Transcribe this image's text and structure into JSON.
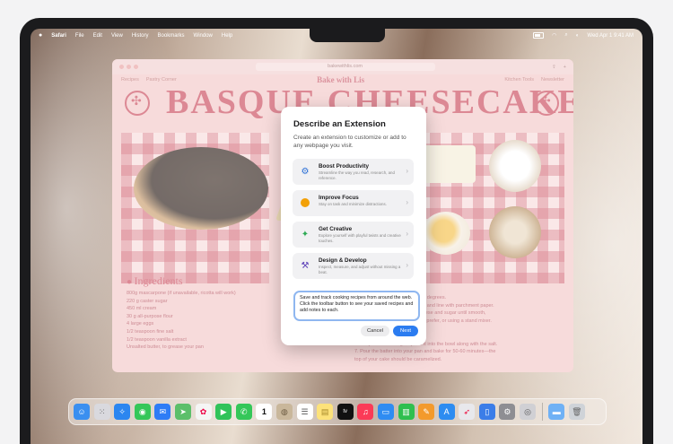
{
  "menubar": {
    "apple": "",
    "app": "Safari",
    "items": [
      "File",
      "Edit",
      "View",
      "History",
      "Bookmarks",
      "Window",
      "Help"
    ],
    "datetime": "Wed Apr 1  9:41 AM"
  },
  "browser": {
    "url": "bakewithlis.com",
    "nav_left": [
      "Recipes",
      "Pastry Corner"
    ],
    "brand": "Bake with Lis",
    "nav_right": [
      "Kitchen Tools",
      "Newsletter"
    ],
    "hero_title": "BASQUE CHEESECAKE",
    "ingredients_title": "Ingredients",
    "ingredients": [
      "800g mascarpone (if unavailable, ricotta will work)",
      "220 g caster sugar",
      "450 ml cream",
      "30 g all-purpose flour",
      "4 large eggs",
      "1/2 teaspoon fine salt",
      "1/2 teaspoon vanilla extract",
      "Unsalted butter, to grease your pan"
    ],
    "steps": [
      "350 degrees.",
      "pan and line with parchment paper.",
      "cheese and sugar until smooth,",
      "you prefer, or using a stand mixer.",
      "",
      "5. Mix in cream until combined.",
      "6. Sift your flour and gently mix it into the bowl along with the salt.",
      "7. Pour the batter into your pan and bake for 50-60 minutes—the",
      "   top of your cake should be caramelized."
    ]
  },
  "modal": {
    "title": "Describe an Extension",
    "description": "Create an extension to customize or add to any webpage you visit.",
    "options": [
      {
        "title": "Boost Productivity",
        "desc": "Streamline the way you read, research, and reference.",
        "icon": "gear-icon",
        "color": "#2b6fd6"
      },
      {
        "title": "Improve Focus",
        "desc": "Stay on task and minimize distractions.",
        "icon": "focus-icon",
        "color": "#f2a007"
      },
      {
        "title": "Get Creative",
        "desc": "Explore yourself with playful twists and creative touches.",
        "icon": "sparkles-icon",
        "color": "#2faa55"
      },
      {
        "title": "Design & Develop",
        "desc": "Inspect, measure, and adjust without missing a beat.",
        "icon": "hammer-icon",
        "color": "#5b3fb8"
      }
    ],
    "prompt": "Save and track cooking recipes from around the web. Click the toolbar button to see your saved recipes and add notes to each.",
    "cancel": "Cancel",
    "next": "Next"
  },
  "dock": {
    "calendar_day": "1",
    "tv_label": "tv",
    "apps": [
      {
        "name": "finder",
        "color": "#3a8ff0"
      },
      {
        "name": "launchpad",
        "color": "#d9d9de"
      },
      {
        "name": "safari",
        "color": "#2b86f0"
      },
      {
        "name": "messages",
        "color": "#34c759"
      },
      {
        "name": "mail",
        "color": "#2e7cf6"
      },
      {
        "name": "maps",
        "color": "#5cbf6a"
      },
      {
        "name": "photos",
        "color": "#f5f5f5"
      },
      {
        "name": "facetime",
        "color": "#30c35a"
      },
      {
        "name": "phone",
        "color": "#34c759"
      },
      {
        "name": "calendar",
        "color": "#ffffff"
      },
      {
        "name": "contacts",
        "color": "#c9b79b"
      },
      {
        "name": "reminders",
        "color": "#ffffff"
      },
      {
        "name": "notes",
        "color": "#fde27a"
      },
      {
        "name": "tv",
        "color": "#111111"
      },
      {
        "name": "music",
        "color": "#fb3b57"
      },
      {
        "name": "keynote",
        "color": "#2f8cf2"
      },
      {
        "name": "numbers",
        "color": "#2fbf4f"
      },
      {
        "name": "pages",
        "color": "#f39a2c"
      },
      {
        "name": "app-store",
        "color": "#2d8cf1"
      },
      {
        "name": "rocket",
        "color": "#e8e8ec"
      },
      {
        "name": "preview",
        "color": "#3b7de8"
      },
      {
        "name": "system-settings",
        "color": "#8e8e93"
      },
      {
        "name": "utility",
        "color": "#d0d0d4"
      },
      {
        "name": "downloads",
        "color": "#6fb1f5"
      },
      {
        "name": "trash",
        "color": "#cfd3d8"
      }
    ]
  }
}
